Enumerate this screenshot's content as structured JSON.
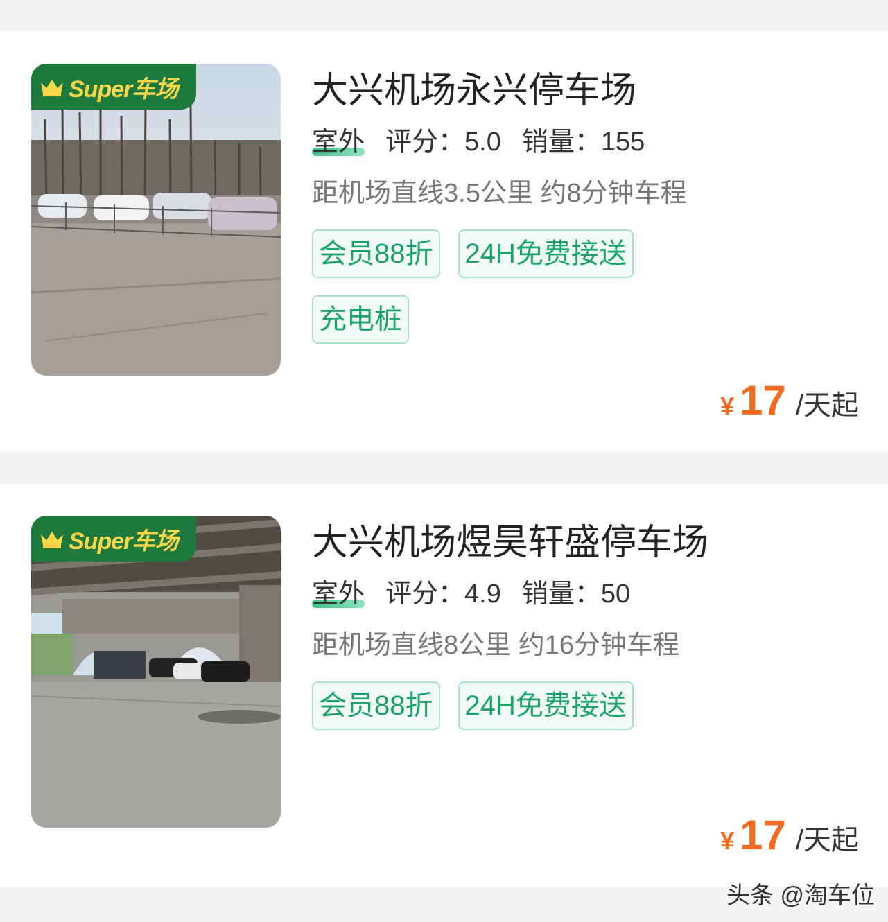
{
  "listings": [
    {
      "badge": "Super车场",
      "title": "大兴机场永兴停车场",
      "env": "室外",
      "rating_label": "评分：",
      "rating": "5.0",
      "sales_label": "销量：",
      "sales": "155",
      "distance": "距机场直线3.5公里 约8分钟车程",
      "tags": [
        "会员88折",
        "24H免费接送",
        "充电桩"
      ],
      "currency": "¥",
      "price": "17",
      "price_unit": "/天起"
    },
    {
      "badge": "Super车场",
      "title": "大兴机场煜昊轩盛停车场",
      "env": "室外",
      "rating_label": "评分：",
      "rating": "4.9",
      "sales_label": "销量：",
      "sales": "50",
      "distance": "距机场直线8公里 约16分钟车程",
      "tags": [
        "会员88折",
        "24H免费接送"
      ],
      "currency": "¥",
      "price": "17",
      "price_unit": "/天起"
    }
  ],
  "watermark": "头条 @淘车位",
  "colors": {
    "accent_green": "#1aa36b",
    "badge_green": "#1e7a3c",
    "badge_text": "#f7d64a",
    "price_orange": "#f26b22"
  }
}
